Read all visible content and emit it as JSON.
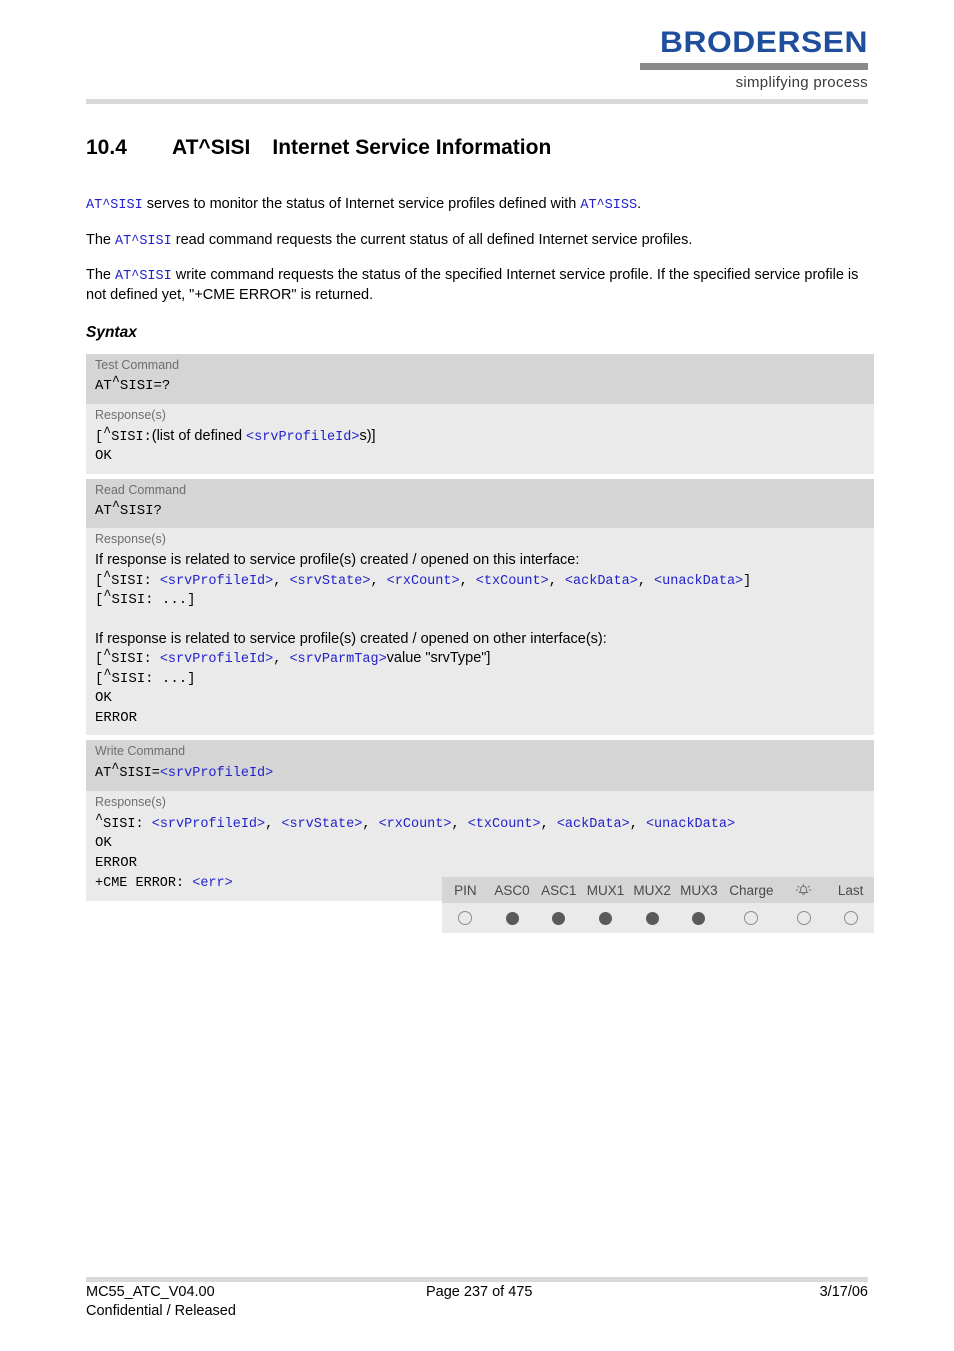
{
  "header": {
    "logo_word": "BRODERSEN",
    "logo_tagline": "simplifying process",
    "logo_color": "#1F4E9C"
  },
  "title": {
    "number": "10.4",
    "command": "AT^SISI",
    "name": "Internet Service Information"
  },
  "intro": {
    "p1_cmd": "AT^SISI",
    "p1_text": " serves to monitor the status of Internet service profiles defined with ",
    "p1_cmd2": "AT^SISS",
    "p1_end": ".",
    "p2_pre": "The ",
    "p2_cmd": "AT^SISI",
    "p2_text": " read command requests the current status of all defined Internet service profiles.",
    "p3_pre": "The ",
    "p3_cmd": "AT^SISI",
    "p3_text": " write command requests the status of the specified Internet service profile. If the specified service profile is not defined yet, \"+CME ERROR\" is returned."
  },
  "syntax_heading": "Syntax",
  "blocks": [
    {
      "label": "Test Command",
      "command": "AT^SISI=?",
      "response_label": "Response(s)",
      "responses": [
        {
          "kind": "mix",
          "parts": [
            {
              "t": "[^SISI:",
              "style": "mono"
            },
            {
              "t": "(list of defined ",
              "style": "text"
            },
            {
              "t": "<srvProfileId>",
              "style": "mono-blue"
            },
            {
              "t": "s)]",
              "style": "text"
            }
          ]
        },
        {
          "kind": "code",
          "text": "OK"
        }
      ]
    },
    {
      "label": "Read Command",
      "command": "AT^SISI?",
      "response_label": "Response(s)",
      "responses": [
        {
          "kind": "text",
          "text": "If response is related to service profile(s) created / opened on this interface:"
        },
        {
          "kind": "mix",
          "parts": [
            {
              "t": "[^SISI: ",
              "style": "mono"
            },
            {
              "t": "<srvProfileId>",
              "style": "mono-blue"
            },
            {
              "t": ", ",
              "style": "mono"
            },
            {
              "t": "<srvState>",
              "style": "mono-blue"
            },
            {
              "t": ", ",
              "style": "mono"
            },
            {
              "t": "<rxCount>",
              "style": "mono-blue"
            },
            {
              "t": ", ",
              "style": "mono"
            },
            {
              "t": "<txCount>",
              "style": "mono-blue"
            },
            {
              "t": ", ",
              "style": "mono"
            },
            {
              "t": "<ackData>",
              "style": "mono-blue"
            },
            {
              "t": ", ",
              "style": "mono"
            },
            {
              "t": "<unackData>",
              "style": "mono-blue"
            },
            {
              "t": "]",
              "style": "mono"
            }
          ]
        },
        {
          "kind": "code",
          "text": "[^SISI: ...]"
        },
        {
          "kind": "spacer"
        },
        {
          "kind": "text",
          "text": "If response is related to service profile(s) created / opened on other interface(s):"
        },
        {
          "kind": "mix",
          "parts": [
            {
              "t": "[^SISI: ",
              "style": "mono"
            },
            {
              "t": "<srvProfileId>",
              "style": "mono-blue"
            },
            {
              "t": ", ",
              "style": "mono"
            },
            {
              "t": "<srvParmTag>",
              "style": "mono-blue"
            },
            {
              "t": "value \"srvType\"]",
              "style": "text"
            }
          ]
        },
        {
          "kind": "code",
          "text": "[^SISI: ...]"
        },
        {
          "kind": "code",
          "text": "OK"
        },
        {
          "kind": "code",
          "text": "ERROR"
        }
      ]
    },
    {
      "label": "Write Command",
      "command_parts": [
        {
          "t": "AT^SISI=",
          "style": "mono"
        },
        {
          "t": "<srvProfileId>",
          "style": "mono-blue"
        }
      ],
      "response_label": "Response(s)",
      "responses": [
        {
          "kind": "mix",
          "parts": [
            {
              "t": "^SISI: ",
              "style": "mono"
            },
            {
              "t": "<srvProfileId>",
              "style": "mono-blue"
            },
            {
              "t": ", ",
              "style": "mono"
            },
            {
              "t": "<srvState>",
              "style": "mono-blue"
            },
            {
              "t": ", ",
              "style": "mono"
            },
            {
              "t": "<rxCount>",
              "style": "mono-blue"
            },
            {
              "t": ", ",
              "style": "mono"
            },
            {
              "t": "<txCount>",
              "style": "mono-blue"
            },
            {
              "t": ", ",
              "style": "mono"
            },
            {
              "t": "<ackData>",
              "style": "mono-blue"
            },
            {
              "t": ", ",
              "style": "mono"
            },
            {
              "t": "<unackData>",
              "style": "mono-blue"
            }
          ]
        },
        {
          "kind": "code",
          "text": "OK"
        },
        {
          "kind": "code",
          "text": "ERROR"
        },
        {
          "kind": "mix",
          "parts": [
            {
              "t": "+CME ERROR: ",
              "style": "mono"
            },
            {
              "t": "<err>",
              "style": "mono-blue"
            }
          ]
        }
      ]
    }
  ],
  "capability_table": {
    "columns": [
      {
        "label": "PIN",
        "state": "empty",
        "icon": null
      },
      {
        "label": "ASC0",
        "state": "filled",
        "icon": null
      },
      {
        "label": "ASC1",
        "state": "filled",
        "icon": null
      },
      {
        "label": "MUX1",
        "state": "filled",
        "icon": null
      },
      {
        "label": "MUX2",
        "state": "filled",
        "icon": null
      },
      {
        "label": "MUX3",
        "state": "filled",
        "icon": null
      },
      {
        "label": "Charge",
        "state": "empty",
        "icon": null
      },
      {
        "label": "",
        "state": "empty",
        "icon": "alarm-bell-icon"
      },
      {
        "label": "Last",
        "state": "empty",
        "icon": null
      }
    ]
  },
  "footer": {
    "doc_id": "MC55_ATC_V04.00",
    "classification": "Confidential / Released",
    "page": "Page 237 of 475",
    "date": "3/17/06"
  }
}
